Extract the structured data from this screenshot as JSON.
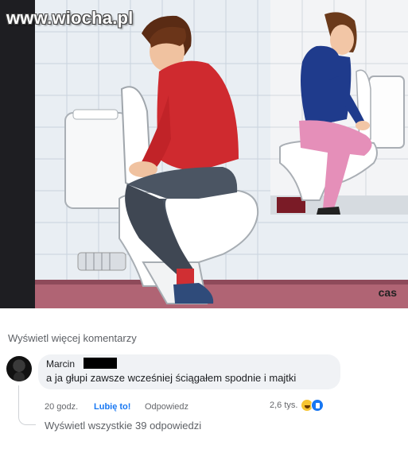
{
  "illustration": {
    "watermark": "www.wiocha.pl",
    "corner_tag": "cas"
  },
  "comments": {
    "more_label": "Wyświetl więcej komentarzy",
    "comment": {
      "author": "Marcin",
      "text": "a ja głupi zawsze wcześniej ściągałem spodnie i majtki",
      "time": "20 godz.",
      "like_label": "Lubię to!",
      "reply_label": "Odpowiedz",
      "reaction_count": "2,6 tys."
    },
    "all_replies_label": "Wyświetl wszystkie 39 odpowiedzi"
  },
  "colors": {
    "link_blue": "#1877f2",
    "bubble_bg": "#f0f2f5",
    "meta_gray": "#65676b"
  },
  "icons": [
    "haha-reaction-icon",
    "like-reaction-icon"
  ]
}
